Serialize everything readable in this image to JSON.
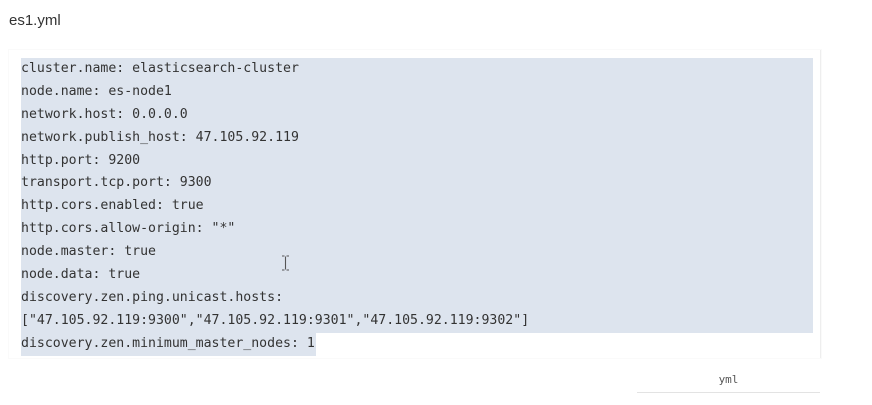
{
  "file": {
    "name": "es1.yml"
  },
  "code": {
    "language_label": "yml",
    "lines": [
      "cluster.name: elasticsearch-cluster",
      "node.name: es-node1",
      "network.host: 0.0.0.0",
      "network.publish_host: 47.105.92.119",
      "http.port: 9200",
      "transport.tcp.port: 9300",
      "http.cors.enabled: true",
      "http.cors.allow-origin: \"*\"",
      "node.master: true",
      "node.data: true",
      "discovery.zen.ping.unicast.hosts:",
      "[\"47.105.92.119:9300\",\"47.105.92.119:9301\",\"47.105.92.119:9302\"]",
      "discovery.zen.minimum_master_nodes: 1"
    ]
  },
  "cursor": {
    "icon": "text-cursor-icon"
  },
  "colors": {
    "selection": "#dde4ee",
    "text": "#333333"
  }
}
